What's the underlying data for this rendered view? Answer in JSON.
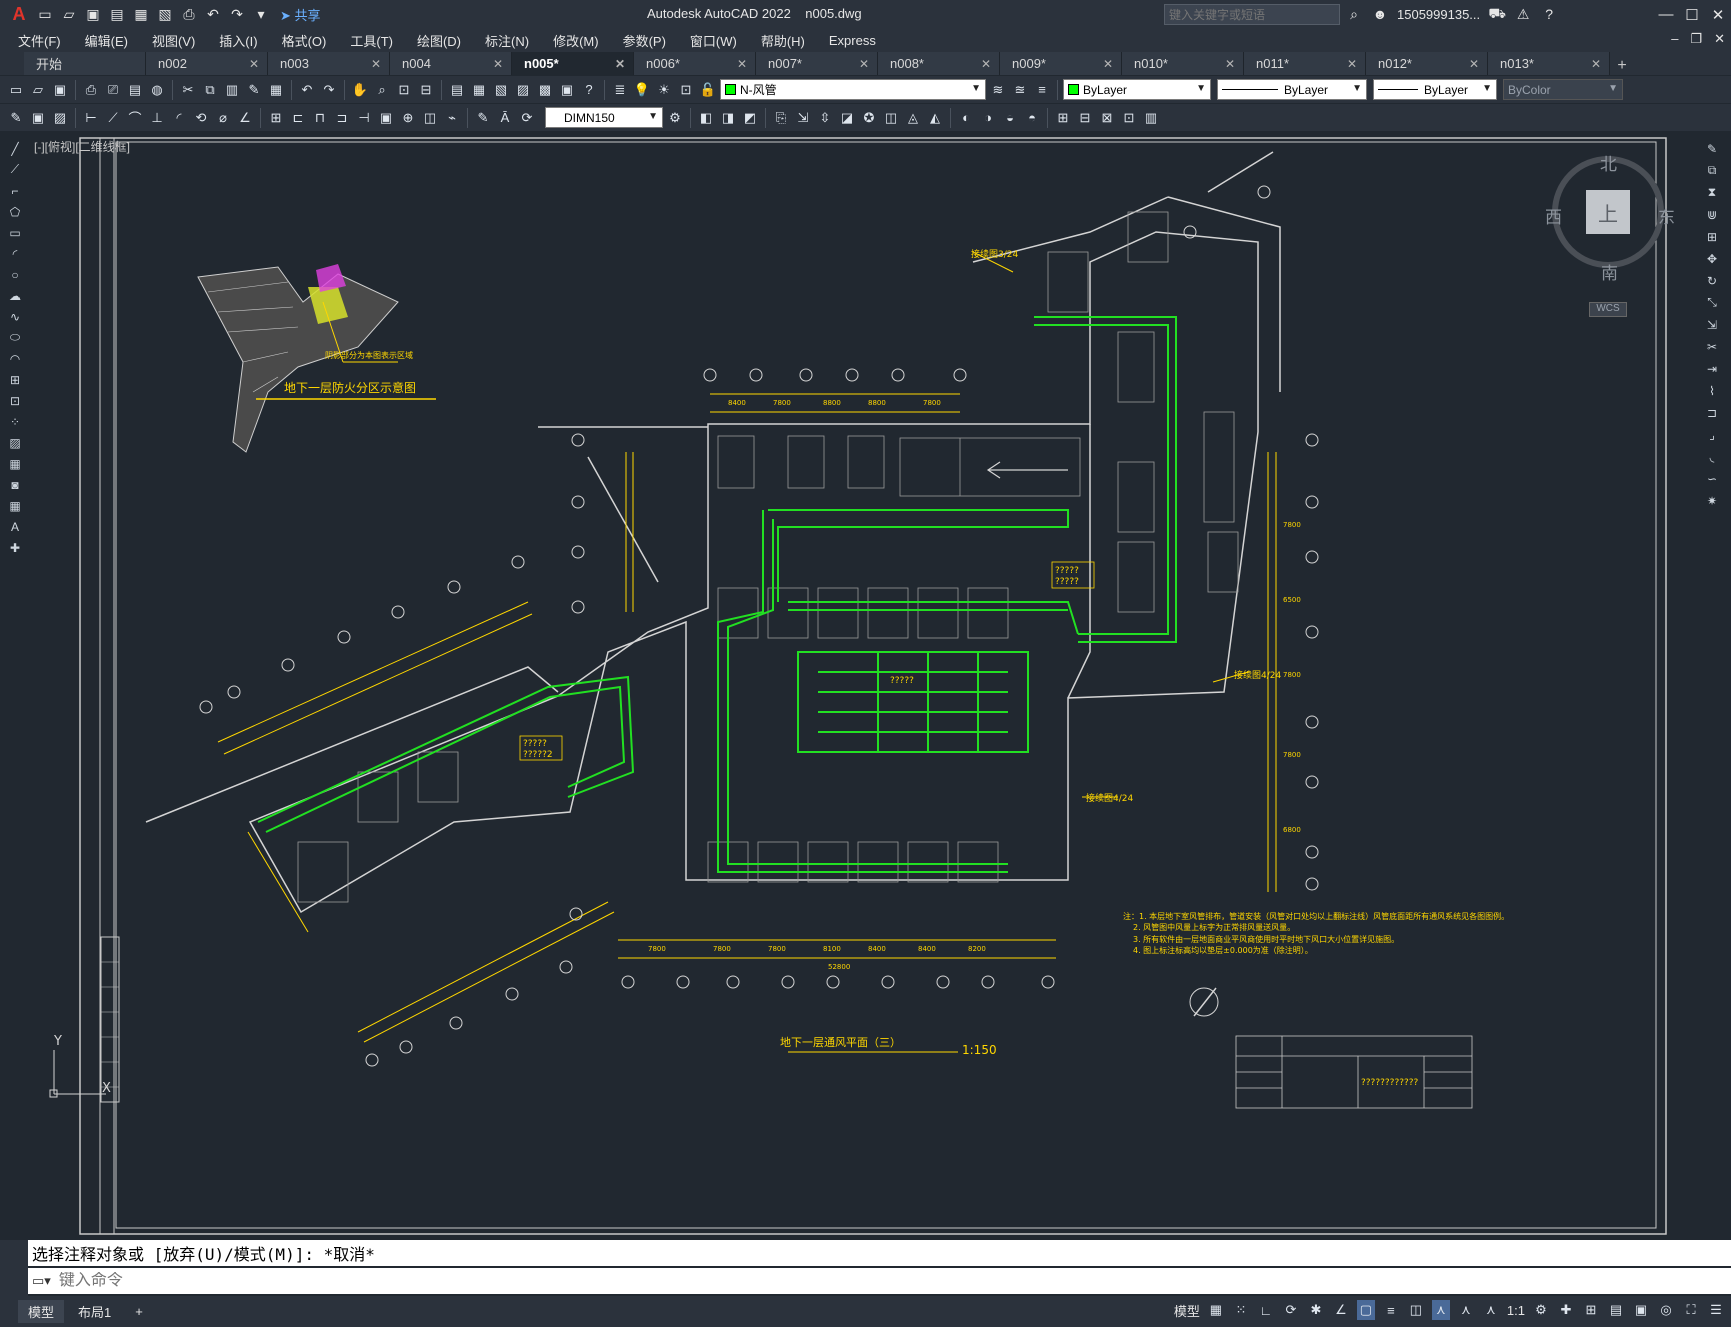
{
  "app": {
    "title": "Autodesk AutoCAD 2022    n005.dwg",
    "share_label": "共享",
    "search_placeholder": "键入关键字或短语",
    "user": "1505999135...",
    "logo_letter": "A"
  },
  "menu": [
    "文件(F)",
    "编辑(E)",
    "视图(V)",
    "插入(I)",
    "格式(O)",
    "工具(T)",
    "绘图(D)",
    "标注(N)",
    "修改(M)",
    "参数(P)",
    "窗口(W)",
    "帮助(H)",
    "Express"
  ],
  "tabs": [
    {
      "label": "开始",
      "active": false
    },
    {
      "label": "n002",
      "active": false
    },
    {
      "label": "n003",
      "active": false
    },
    {
      "label": "n004",
      "active": false
    },
    {
      "label": "n005*",
      "active": true
    },
    {
      "label": "n006*",
      "active": false
    },
    {
      "label": "n007*",
      "active": false
    },
    {
      "label": "n008*",
      "active": false
    },
    {
      "label": "n009*",
      "active": false
    },
    {
      "label": "n010*",
      "active": false
    },
    {
      "label": "n011*",
      "active": false
    },
    {
      "label": "n012*",
      "active": false
    },
    {
      "label": "n013*",
      "active": false
    }
  ],
  "properties": {
    "layer": "N-风管",
    "color": "ByLayer",
    "linetype": "ByLayer",
    "lineweight": "ByLayer",
    "plotstyle": "ByColor",
    "dimstyle": "DIMN150",
    "layer_color": "#00ff00"
  },
  "viewport": {
    "label": "[-][俯视][二维线框]"
  },
  "viewcube": {
    "north": "北",
    "south": "南",
    "east": "东",
    "west": "西",
    "face": "上",
    "wcs": "WCS"
  },
  "drawing": {
    "key_plan_title": "地下一层防火分区示意图",
    "key_plan_note": "阴影部分为本图表示区域",
    "plan_title": "地下一层通风平面（三）",
    "scale": "1:150",
    "match_line_1": "接续图3/24",
    "match_line_2": "接续图4/24",
    "match_line_3": "接续图4/24",
    "notes": [
      "注：1. 本层地下室风管排布，管道安装（风管对口处均以上翻标注线）风管底面距所有通风系统见各图图例。",
      "2. 风管图中风量上标字为正常排风量送风量。",
      "3. 所有软件由一层地面商业平风商使用时平时地下风口大小位置详见施图。",
      "4. 图上标注标高均以垫层±0.000为准（除注明）。"
    ],
    "placeholder_labels": [
      "?????",
      "?????",
      "?????",
      "?????2",
      "?????"
    ],
    "title_block_code": "????????????",
    "dims_bottom": [
      "7800",
      "7800",
      "7800",
      "8100",
      "8400",
      "8400",
      "8200"
    ],
    "dims_bottom_total": "52800",
    "dims_top": [
      "8400",
      "7800",
      "8800",
      "8800",
      "7800"
    ],
    "dims_right": [
      "7800",
      "6500",
      "7800",
      "7800",
      "6800"
    ]
  },
  "command": {
    "history": "选择注释对象或 [放弃(U)/模式(M)]: *取消*",
    "placeholder": "键入命令"
  },
  "status": {
    "tabs": [
      {
        "label": "模型",
        "active": true
      },
      {
        "label": "布局1",
        "active": false
      }
    ],
    "model_label": "模型",
    "scale": "1:1"
  }
}
